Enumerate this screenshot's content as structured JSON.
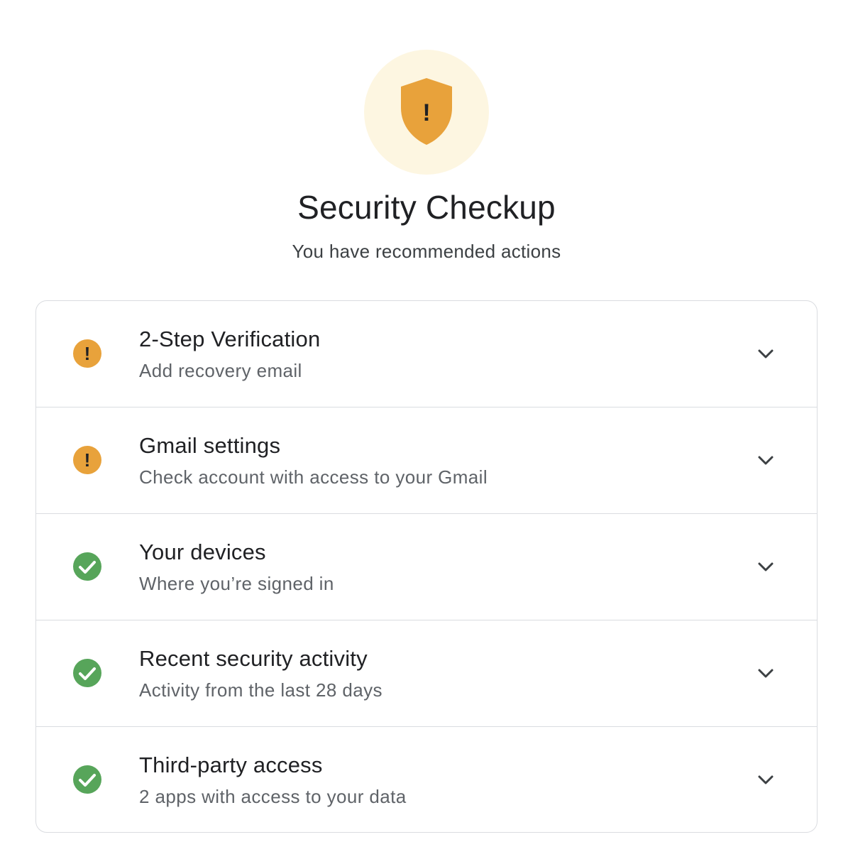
{
  "header": {
    "shield_icon": "shield-warning-icon",
    "shield_mark": "!",
    "title": "Security Checkup",
    "subtitle": "You have recommended actions"
  },
  "colors": {
    "warning": "#e8a23b",
    "success": "#57a55a",
    "hero_background": "#fdf6e1"
  },
  "items": [
    {
      "status": "warning",
      "status_icon": "warning-circle-icon",
      "status_mark": "!",
      "title": "2-Step Verification",
      "subtitle": "Add recovery email",
      "chevron_icon": "chevron-down-icon"
    },
    {
      "status": "warning",
      "status_icon": "warning-circle-icon",
      "status_mark": "!",
      "title": "Gmail settings",
      "subtitle": "Check account with access to your Gmail",
      "chevron_icon": "chevron-down-icon"
    },
    {
      "status": "ok",
      "status_icon": "check-circle-icon",
      "title": "Your devices",
      "subtitle": "Where you’re signed in",
      "chevron_icon": "chevron-down-icon"
    },
    {
      "status": "ok",
      "status_icon": "check-circle-icon",
      "title": "Recent security activity",
      "subtitle": "Activity from the last 28 days",
      "chevron_icon": "chevron-down-icon"
    },
    {
      "status": "ok",
      "status_icon": "check-circle-icon",
      "title": "Third-party access",
      "subtitle": "2 apps with access to your data",
      "chevron_icon": "chevron-down-icon"
    }
  ]
}
